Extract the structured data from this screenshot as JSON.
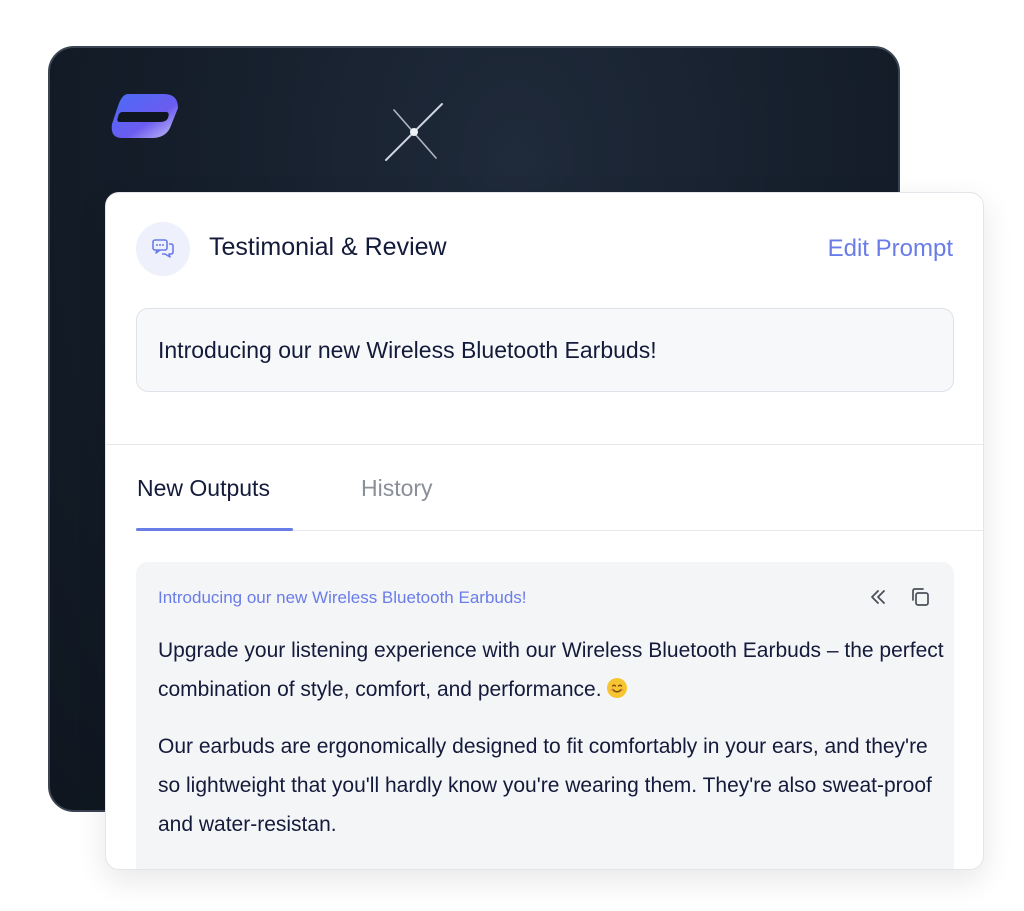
{
  "header": {
    "title": "Testimonial & Review",
    "edit_label": "Edit Prompt",
    "icon": "chat-bubbles-icon"
  },
  "prompt": {
    "text": "Introducing our new Wireless Bluetooth Earbuds!"
  },
  "tabs": [
    {
      "label": "New Outputs",
      "active": true
    },
    {
      "label": "History",
      "active": false
    }
  ],
  "output": {
    "title": "Introducing our new Wireless Bluetooth Earbuds!",
    "paragraphs": [
      "Upgrade your listening experience with our Wireless Bluetooth Earbuds – the perfect combination of style, comfort, and performance.",
      "Our earbuds are ergonomically designed to fit comfortably in your ears, and they're so lightweight that you'll hardly know you're wearing them. They're also sweat-proof and water-resistan."
    ],
    "icons": [
      "collapse-icon",
      "copy-icon",
      "smiling-face-emoji"
    ]
  },
  "colors": {
    "accent": "#6a7ce8",
    "text": "#141a3a",
    "muted": "#8a8f99",
    "dark_panel": "#141d29",
    "card_bg": "#ffffff",
    "output_bg": "#f4f5f7"
  }
}
